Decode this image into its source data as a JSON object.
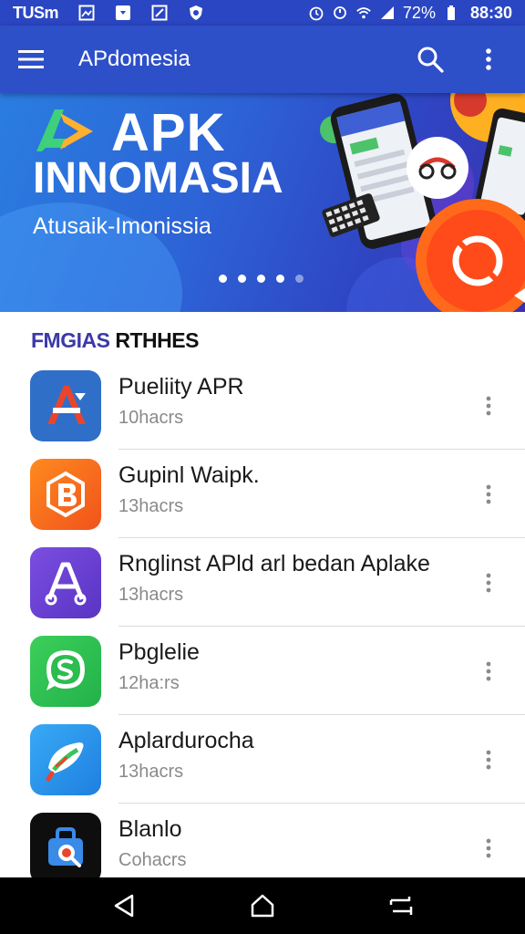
{
  "status_bar": {
    "carrier": "TUSm",
    "battery": "72%",
    "time": "88:30"
  },
  "app_bar": {
    "title": "APdomesia"
  },
  "banner": {
    "headline_line1": "APK",
    "headline_line2": "INNOMASIA",
    "subtitle": "Atusaik-Imonissia",
    "carousel_active_index": 0,
    "carousel_count": 5
  },
  "section": {
    "heading_accent": "FMGIAS",
    "heading_rest": " RTHHES"
  },
  "apps": [
    {
      "name": "Pueliity APR",
      "meta": "10hacrs",
      "icon": "red-a-icon"
    },
    {
      "name": "Gupinl Waipk.",
      "meta": "13hacrs",
      "icon": "orange-b-icon"
    },
    {
      "name": "Rnglinst APld   arl bedan Aplake",
      "meta": "13hacrs",
      "icon": "purple-a-icon"
    },
    {
      "name": "Pbglelie",
      "meta": "12ha:rs",
      "icon": "green-chat-icon"
    },
    {
      "name": "Aplardurocha",
      "meta": "13hacrs",
      "icon": "blue-feather-icon"
    },
    {
      "name": "Blanlo",
      "meta": "Cohacrs",
      "icon": "black-bag-icon"
    }
  ],
  "colors": {
    "primary": "#2d4fc8",
    "status_bar": "#2a46c2",
    "nav_bar": "#000000"
  }
}
